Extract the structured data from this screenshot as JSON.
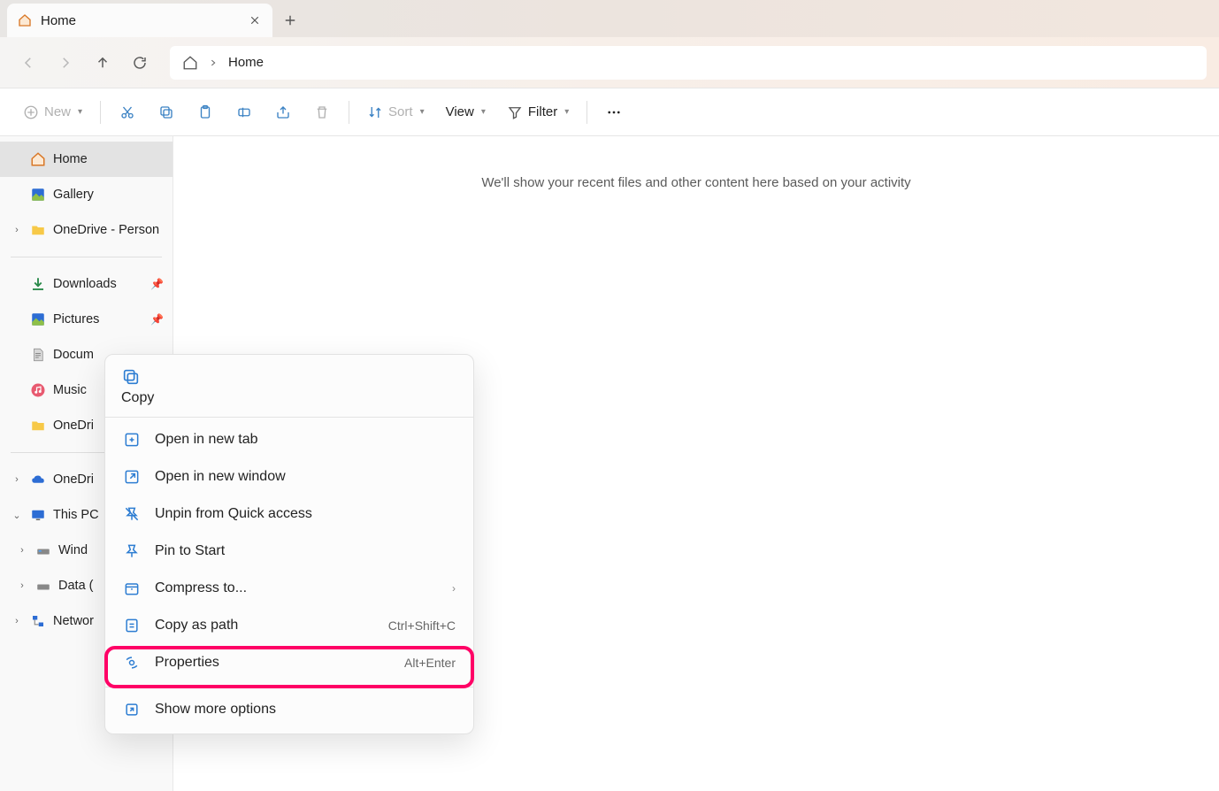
{
  "tab": {
    "title": "Home"
  },
  "address": {
    "crumb": "Home"
  },
  "toolbar": {
    "new": "New",
    "sort": "Sort",
    "view": "View",
    "filter": "Filter"
  },
  "sidebar": {
    "home": "Home",
    "gallery": "Gallery",
    "onedrive_personal": "OneDrive - Person",
    "downloads": "Downloads",
    "pictures": "Pictures",
    "documents": "Docum",
    "music": "Music",
    "onedrive_quick": "OneDri",
    "onedrive": "OneDri",
    "this_pc": "This PC",
    "windows": "Wind",
    "data": "Data (",
    "network": "Networ"
  },
  "content": {
    "message": "We'll show your recent files and other content here based on your activity"
  },
  "context_menu": {
    "copy": "Copy",
    "open_new_tab": "Open in new tab",
    "open_new_window": "Open in new window",
    "unpin": "Unpin from Quick access",
    "pin_start": "Pin to Start",
    "compress": "Compress to...",
    "copy_path": "Copy as path",
    "copy_path_shortcut": "Ctrl+Shift+C",
    "properties": "Properties",
    "properties_shortcut": "Alt+Enter",
    "show_more": "Show more options"
  }
}
